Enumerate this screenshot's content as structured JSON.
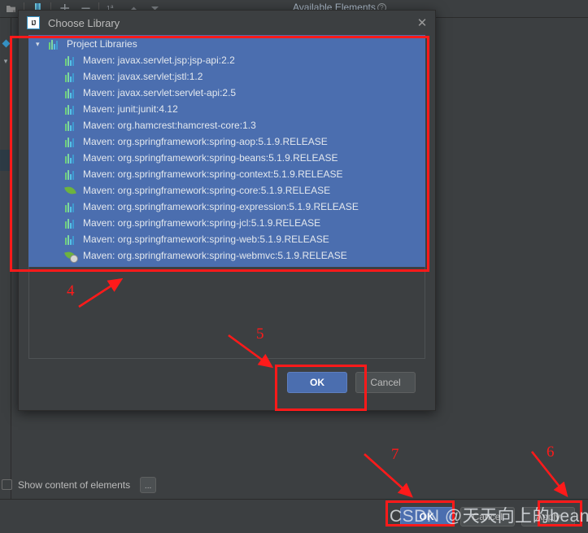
{
  "background_window": {
    "toolbar_icons": [
      "module-icon",
      "library-icon",
      "add-icon",
      "remove-icon",
      "sort-icon",
      "move-up-icon",
      "move-down-icon"
    ],
    "available_elements_title": "Available Elements",
    "help_badge": "?",
    "left_sidebar_icons": [
      "artifact-icon",
      "chevron-down-icon"
    ],
    "show_content_checkbox_label": "Show content of elements",
    "ellipsis_button_label": "...",
    "footer_buttons": [
      {
        "label": "OK",
        "style": "primary"
      },
      {
        "label": "Cancel",
        "style": "default"
      },
      {
        "label": "Apply",
        "style": "default"
      }
    ]
  },
  "dialog": {
    "title": "Choose Library",
    "logo_text": "IJ",
    "close_icon": "close-icon",
    "tree": {
      "root": {
        "label": "Project Libraries",
        "expand_icon": "chevron-down-icon",
        "icon": "library-icon"
      },
      "items": [
        {
          "label": "Maven: javax.servlet.jsp:jsp-api:2.2",
          "icon": "library-icon"
        },
        {
          "label": "Maven: javax.servlet:jstl:1.2",
          "icon": "library-icon"
        },
        {
          "label": "Maven: javax.servlet:servlet-api:2.5",
          "icon": "library-icon"
        },
        {
          "label": "Maven: junit:junit:4.12",
          "icon": "library-icon"
        },
        {
          "label": "Maven: org.hamcrest:hamcrest-core:1.3",
          "icon": "library-icon"
        },
        {
          "label": "Maven: org.springframework:spring-aop:5.1.9.RELEASE",
          "icon": "library-icon"
        },
        {
          "label": "Maven: org.springframework:spring-beans:5.1.9.RELEASE",
          "icon": "library-icon"
        },
        {
          "label": "Maven: org.springframework:spring-context:5.1.9.RELEASE",
          "icon": "library-icon"
        },
        {
          "label": "Maven: org.springframework:spring-core:5.1.9.RELEASE",
          "icon": "spring-leaf-icon"
        },
        {
          "label": "Maven: org.springframework:spring-expression:5.1.9.RELEASE",
          "icon": "library-icon"
        },
        {
          "label": "Maven: org.springframework:spring-jcl:5.1.9.RELEASE",
          "icon": "library-icon"
        },
        {
          "label": "Maven: org.springframework:spring-web:5.1.9.RELEASE",
          "icon": "library-icon"
        },
        {
          "label": "Maven: org.springframework:spring-webmvc:5.1.9.RELEASE",
          "icon": "spring-leaf-badge-icon"
        }
      ]
    },
    "buttons": [
      {
        "label": "OK",
        "style": "primary"
      },
      {
        "label": "Cancel",
        "style": "default"
      }
    ]
  },
  "annotations": {
    "labels": [
      "4",
      "5",
      "7",
      "6"
    ],
    "color": "#FF1A1A"
  },
  "watermark": {
    "text": "CSDN @天天向上的bean"
  },
  "theme": {
    "window_bg": "#3C3F41",
    "selection_blue": "#4B6EAF",
    "text": "#BBBBBB",
    "accent_red": "#FF1A1A"
  }
}
